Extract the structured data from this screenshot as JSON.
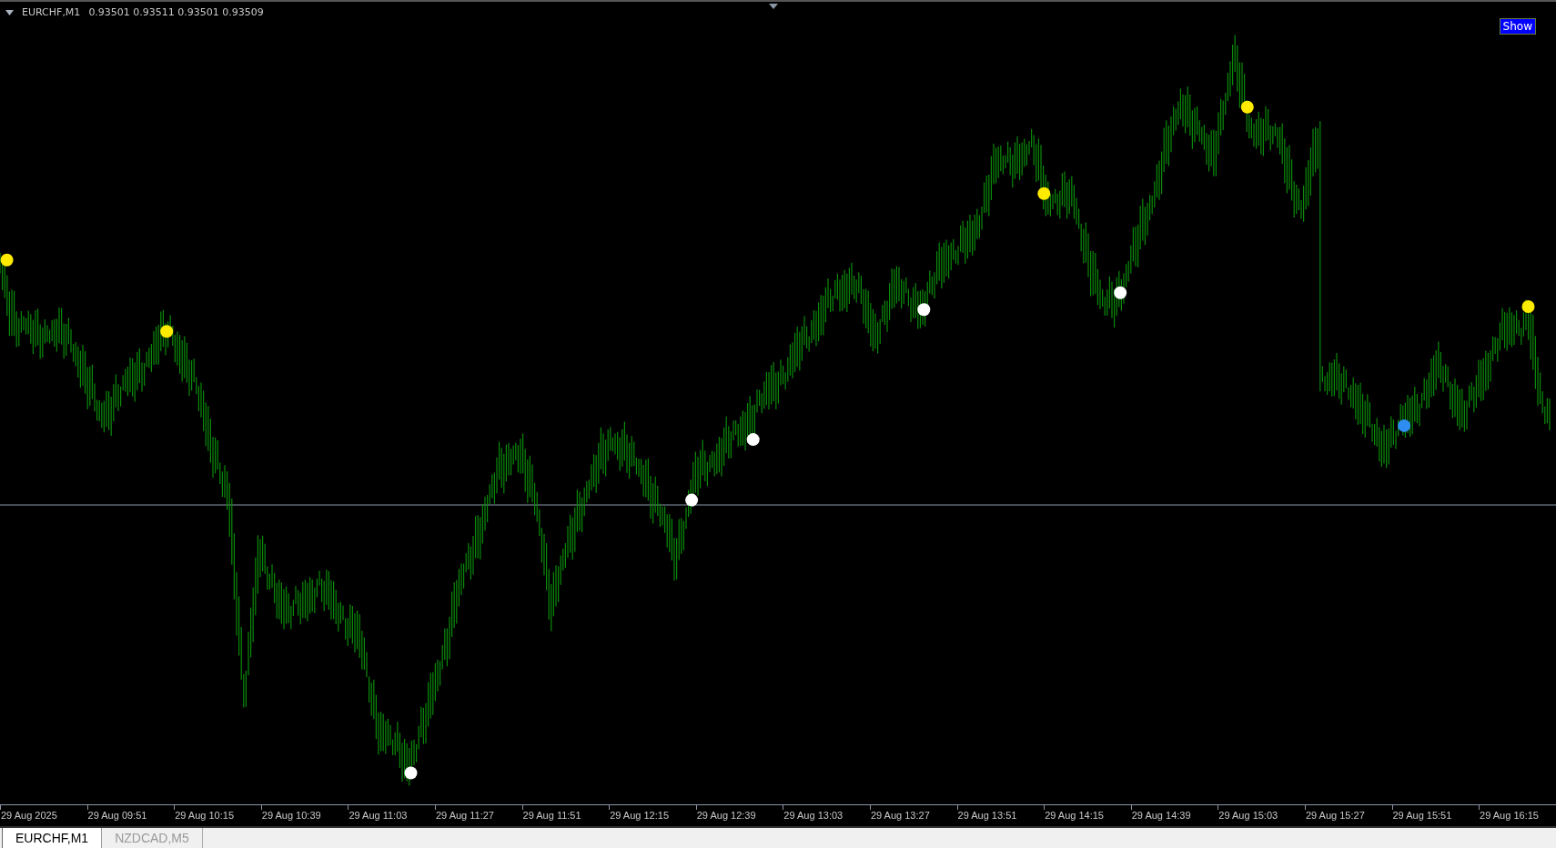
{
  "chart_header": {
    "symbol": "EURCHF,M1",
    "quotes": "0.93501 0.93511 0.93501 0.93509"
  },
  "show_button": {
    "label": "Show"
  },
  "signals": [
    {
      "color": "#ffeb00"
    },
    {
      "color": "#ffeb00"
    },
    {
      "color": "#ffffff"
    },
    {
      "color": "#ffffff"
    },
    {
      "color": "#ffffff"
    },
    {
      "color": "#ffffff"
    },
    {
      "color": "#ffeb00"
    },
    {
      "color": "#ffffff"
    },
    {
      "color": "#ffeb00"
    },
    {
      "color": "#2f8cf0"
    },
    {
      "color": "#ffeb00"
    }
  ],
  "time_axis": [
    "29 Aug 2025",
    "29 Aug 09:51",
    "29 Aug 10:15",
    "29 Aug 10:39",
    "29 Aug 11:03",
    "29 Aug 11:27",
    "29 Aug 11:51",
    "29 Aug 12:15",
    "29 Aug 12:39",
    "29 Aug 13:03",
    "29 Aug 13:27",
    "29 Aug 13:51",
    "29 Aug 14:15",
    "29 Aug 14:39",
    "29 Aug 15:03",
    "29 Aug 15:27",
    "29 Aug 15:51",
    "29 Aug 16:15"
  ],
  "tabs": [
    {
      "label": "EURCHF,M1",
      "selected": true
    },
    {
      "label": "NZDCAD,M5",
      "selected": false
    }
  ]
}
